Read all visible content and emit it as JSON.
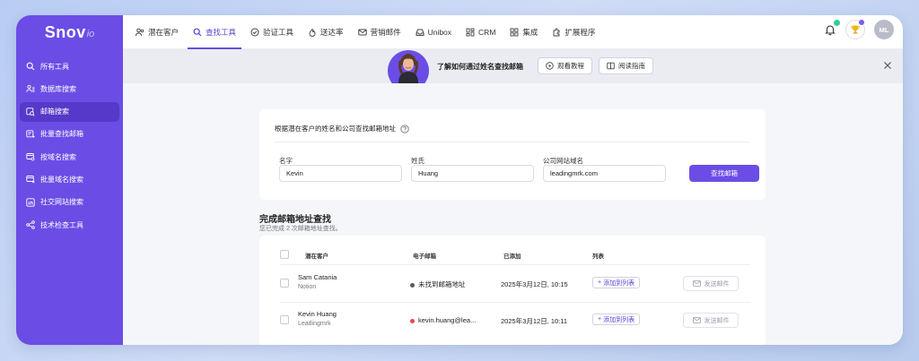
{
  "brand": {
    "name": "Snov",
    "suffix": "io",
    "accent": "#6b4de6"
  },
  "nav": {
    "items": [
      {
        "label": "潜在客户"
      },
      {
        "label": "查找工具"
      },
      {
        "label": "验证工具"
      },
      {
        "label": "送达率"
      },
      {
        "label": "营销邮件"
      },
      {
        "label": "Unibox"
      },
      {
        "label": "CRM"
      },
      {
        "label": "集成"
      },
      {
        "label": "扩展程序"
      }
    ],
    "active_index": 1
  },
  "user": {
    "initials": "ML"
  },
  "sidebar": {
    "items": [
      {
        "label": "所有工具"
      },
      {
        "label": "数据库搜索"
      },
      {
        "label": "邮箱搜索"
      },
      {
        "label": "批量查找邮箱"
      },
      {
        "label": "按域名搜索"
      },
      {
        "label": "批量域名搜索"
      },
      {
        "label": "社交网站搜索"
      },
      {
        "label": "技术检查工具"
      }
    ],
    "active_index": 2
  },
  "banner": {
    "text": "了解如何通过姓名查找邮箱",
    "watch_label": "观看教程",
    "guide_label": "阅读指南"
  },
  "search": {
    "title": "根据潜在客户的姓名和公司查找邮箱地址",
    "first_name_label": "名字",
    "first_name_value": "Kevin",
    "last_name_label": "姓氏",
    "last_name_value": "Huang",
    "domain_label": "公司网站域名",
    "domain_value": "leadingmrk.com",
    "button_label": "查找邮箱"
  },
  "results": {
    "title": "完成邮箱地址查找",
    "subtitle": "您已完成 2 次邮箱地址查找。",
    "columns": [
      "潜在客户",
      "电子邮箱",
      "已添加",
      "列表"
    ],
    "add_list_label": "添加到列表",
    "send_label": "发送邮件",
    "rows": [
      {
        "name": "Sam Catania",
        "company": "Notion",
        "email": "未找到邮箱地址",
        "status_color": "#555b66",
        "added": "2025年3月12日, 10:15"
      },
      {
        "name": "Kevin Huang",
        "company": "Leadingmrk",
        "email": "kevin.huang@lea...",
        "status_color": "#e5484d",
        "added": "2025年3月12日, 10:11"
      }
    ]
  }
}
